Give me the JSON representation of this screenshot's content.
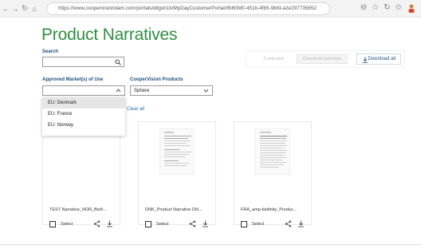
{
  "browser": {
    "url": "https://www.coopervisiondam.com/portals/kllgsh1b/MyDayCustomerPortal#fb60fd0-451b-4fb5-9bfd-a2e297735652"
  },
  "page": {
    "title": "Product Narratives"
  },
  "search": {
    "label": "Search",
    "value": ""
  },
  "toolbar": {
    "selected_count": "0 selected",
    "download_selection": "Download selection",
    "download_all": "Download all"
  },
  "filters": {
    "market_label": "Approved Market(s) of Use",
    "market_value": "",
    "market_options": [
      "EU: Denmark",
      "EU: France",
      "EU: Norway"
    ],
    "products_label": "CooperVision Products",
    "products_value": "Sphere",
    "clear_all": "Clear all"
  },
  "cards": [
    {
      "title": "TEST Narrative_NOR_Biofi..."
    },
    {
      "title": "DNK_Product Narrative DN..."
    },
    {
      "title": "FRA_amp-biofinity_Produc..."
    }
  ],
  "card_action": {
    "select_label": "Select"
  },
  "colors": {
    "title_green": "#2f8f3f",
    "label_blue": "#1f4e79",
    "link_blue": "#1f6fb5"
  }
}
